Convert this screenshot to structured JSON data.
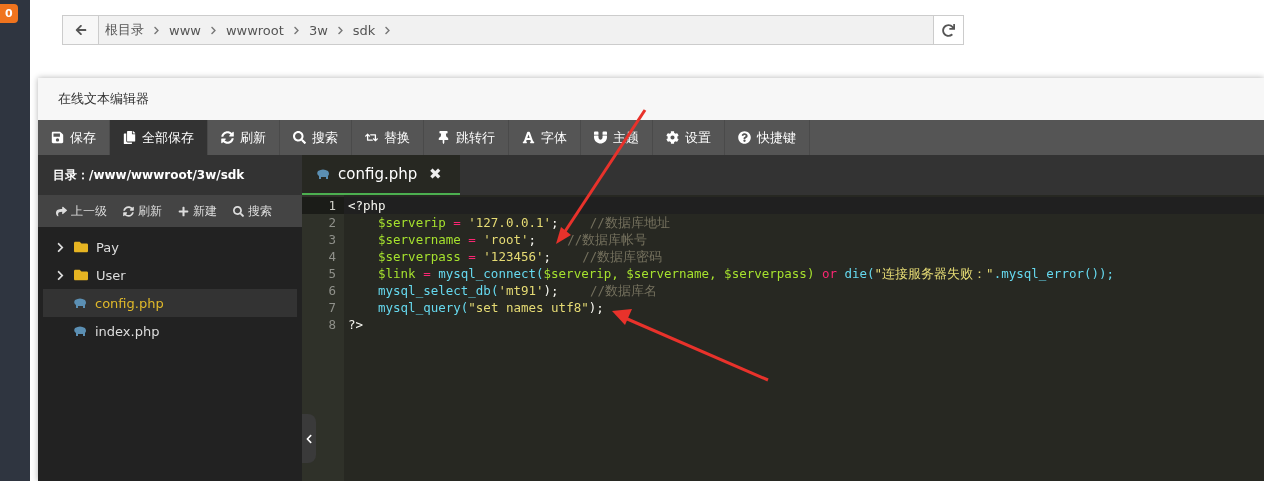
{
  "side_badge": "0",
  "breadcrumb": {
    "items": [
      "根目录",
      "www",
      "wwwroot",
      "3w",
      "sdk"
    ]
  },
  "editor_window": {
    "title": "在线文本编辑器",
    "toolbar": [
      {
        "label": "保存",
        "selected": false
      },
      {
        "label": "全部保存",
        "selected": true
      },
      {
        "label": "刷新",
        "selected": false
      },
      {
        "label": "搜索",
        "selected": false
      },
      {
        "label": "替换",
        "selected": false
      },
      {
        "label": "跳转行",
        "selected": false
      },
      {
        "label": "字体",
        "selected": false
      },
      {
        "label": "主题",
        "selected": false
      },
      {
        "label": "设置",
        "selected": false
      },
      {
        "label": "快捷键",
        "selected": false
      }
    ],
    "sidebar": {
      "path": "目录：/www/wwwroot/3w/sdk",
      "actions": [
        "上一级",
        "刷新",
        "新建",
        "搜索"
      ],
      "items": [
        {
          "kind": "folder",
          "name": "Pay",
          "expanded": false,
          "selected": false
        },
        {
          "kind": "folder",
          "name": "User",
          "expanded": false,
          "selected": false
        },
        {
          "kind": "file",
          "name": "config.php",
          "selected": true
        },
        {
          "kind": "file",
          "name": "index.php",
          "selected": false
        }
      ]
    },
    "tab": {
      "name": "config.php",
      "close": "✖"
    },
    "code_lines": [
      {
        "number": "1",
        "active": true,
        "indented": false,
        "tokens": [
          {
            "kind": "plain",
            "text": "<?php"
          }
        ]
      },
      {
        "number": "2",
        "active": false,
        "indented": true,
        "tokens": [
          {
            "kind": "var",
            "text": "$serverip"
          },
          {
            "kind": "op",
            "text": "="
          },
          {
            "kind": "str",
            "text": "'127.0.0.1'"
          },
          {
            "kind": "plain",
            "text": ";"
          },
          {
            "kind": "comment",
            "text": "//数据库地址"
          }
        ]
      },
      {
        "number": "3",
        "active": false,
        "indented": true,
        "tokens": [
          {
            "kind": "var",
            "text": "$servername"
          },
          {
            "kind": "op",
            "text": "="
          },
          {
            "kind": "str",
            "text": "'root'"
          },
          {
            "kind": "plain",
            "text": ";"
          },
          {
            "kind": "comment",
            "text": "//数据库帐号"
          }
        ]
      },
      {
        "number": "4",
        "active": false,
        "indented": true,
        "tokens": [
          {
            "kind": "var",
            "text": "$serverpass"
          },
          {
            "kind": "op",
            "text": "="
          },
          {
            "kind": "str",
            "text": "'123456'"
          },
          {
            "kind": "plain",
            "text": ";"
          },
          {
            "kind": "comment",
            "text": "//数据库密码"
          }
        ]
      },
      {
        "number": "5",
        "active": false,
        "indented": true,
        "tokens": [
          {
            "kind": "var",
            "text": "$link"
          },
          {
            "kind": "op",
            "text": "="
          },
          {
            "kind": "func",
            "text": "mysql_connect("
          },
          {
            "kind": "var",
            "text": "$serverip,"
          },
          {
            "kind": "var",
            "text": "$servername,"
          },
          {
            "kind": "var",
            "text": "$serverpass)"
          },
          {
            "kind": "op",
            "text": "or"
          },
          {
            "kind": "func",
            "text": "die("
          },
          {
            "kind": "str",
            "text": "\"连接服务器失败：\""
          },
          {
            "kind": "func",
            "text": ".mysql_error());"
          }
        ]
      },
      {
        "number": "6",
        "active": false,
        "indented": true,
        "tokens": [
          {
            "kind": "func",
            "text": "mysql_select_db("
          },
          {
            "kind": "str",
            "text": "'mt91'"
          },
          {
            "kind": "plain",
            "text": ");"
          },
          {
            "kind": "comment",
            "text": "//数据库名"
          }
        ]
      },
      {
        "number": "7",
        "active": false,
        "indented": true,
        "tokens": [
          {
            "kind": "func",
            "text": "mysql_query("
          },
          {
            "kind": "str",
            "text": "\"set names utf8\""
          },
          {
            "kind": "plain",
            "text": ");"
          }
        ]
      },
      {
        "number": "8",
        "active": false,
        "indented": false,
        "tokens": [
          {
            "kind": "plain",
            "text": "?>"
          }
        ]
      }
    ]
  }
}
